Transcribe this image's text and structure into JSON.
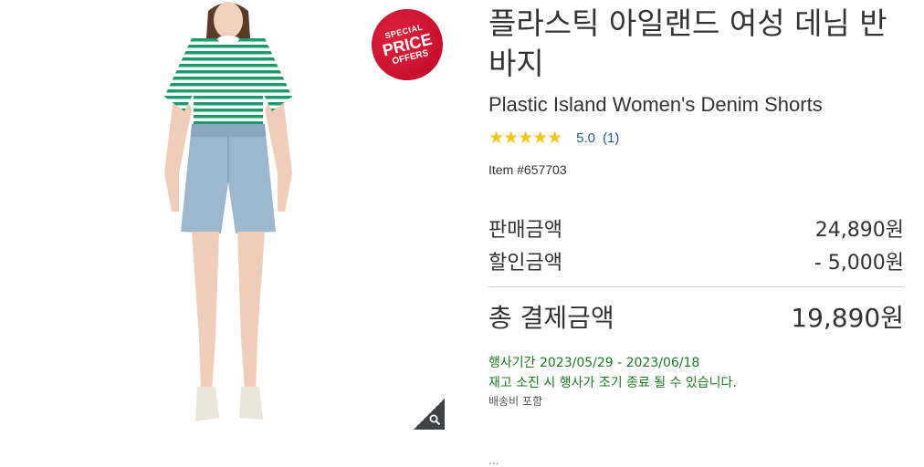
{
  "badge": {
    "line1": "SPECIAL",
    "line2": "PRICE",
    "line3": "OFFERS"
  },
  "product": {
    "title_ko": "플라스틱 아일랜드 여성 데님 반바지",
    "title_en": "Plastic Island Women's Denim Shorts",
    "rating_stars": "★★★★★",
    "rating_value": "5.0",
    "rating_count": "(1)",
    "item_number": "Item #657703"
  },
  "pricing": {
    "sale_label": "판매금액",
    "sale_value": "24,890원",
    "discount_label": "할인금액",
    "discount_value": "- 5,000원",
    "total_label": "총 결제금액",
    "total_value": "19,890원"
  },
  "promo": {
    "period": "행사기간 2023/05/29 - 2023/06/18",
    "notice": "재고 소진 시 행사가 조기 종료 될 수 있습니다.",
    "shipping": "배송비 포함",
    "cut_off": "..."
  },
  "colors": {
    "badge_red": "#c8102e",
    "star_yellow": "#f5c518",
    "promo_green": "#1a7b21",
    "link_blue": "#1f5e9a"
  }
}
